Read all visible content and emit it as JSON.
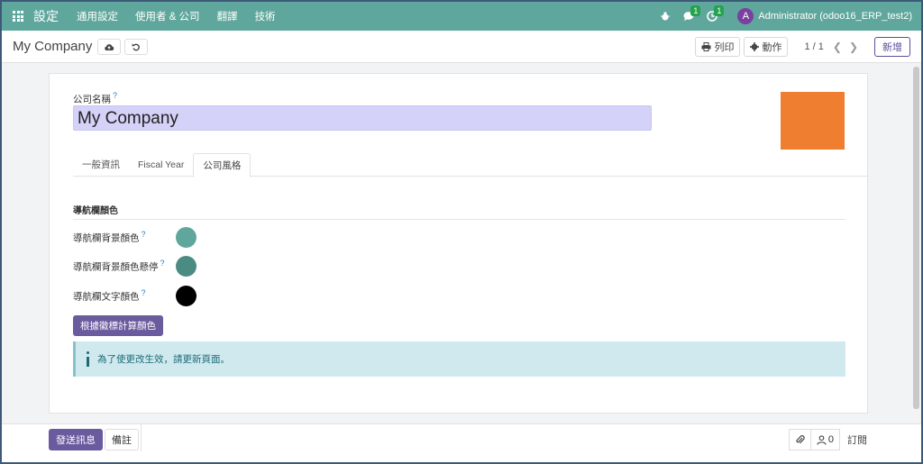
{
  "navbar": {
    "brand": "設定",
    "menu": [
      "通用設定",
      "使用者 & 公司",
      "翻譯",
      "技術"
    ],
    "messages_count": "1",
    "activities_count": "1",
    "avatar_letter": "A",
    "user": "Administrator (odoo16_ERP_test2)"
  },
  "control_panel": {
    "breadcrumb": "My Company",
    "print_label": "列印",
    "action_label": "動作",
    "pager": "1 / 1",
    "new_label": "新增"
  },
  "form": {
    "company_label": "公司名稱",
    "help_mark": "?",
    "company_name": "My Company",
    "logo_color": "#ef7e31",
    "tabs": [
      "一般資訊",
      "Fiscal Year",
      "公司風格"
    ],
    "active_tab": "公司風格",
    "section_title": "導航欄顏色",
    "fields": [
      {
        "label": "導航欄背景顏色",
        "color": "#5fa79c"
      },
      {
        "label": "導航欄背景顏色懸停",
        "color": "#4a8c81"
      },
      {
        "label": "導航欄文字顏色",
        "color": "#000000"
      }
    ],
    "compute_button": "根據徽標計算顏色",
    "alert_text": "為了使更改生效，請更新頁面。"
  },
  "chatter": {
    "send_message": "發送訊息",
    "log_note": "備註",
    "followers_count": "0",
    "follow_label": "訂閱"
  }
}
